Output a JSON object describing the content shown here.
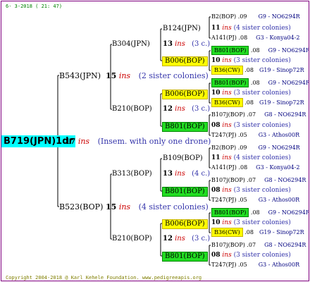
{
  "date_line": "6- 3-2018 ( 21: 47)",
  "copyright": "Copyright 2004-2018 @ Karl Kehele Foundation.  www.pedigreeapis.org",
  "root": {
    "name": "B719(JPN)1dr",
    "num": "17",
    "ins": "ins",
    "note": "(Insem. with only one drone)"
  },
  "gen1": [
    {
      "name": "B543(JPN)",
      "num": "15",
      "ins": "ins",
      "note": "(2 sister colonies)"
    },
    {
      "name": "B523(BOP)",
      "num": "15",
      "ins": "ins",
      "note": "(4 sister colonies)"
    }
  ],
  "gen2": [
    {
      "name": "B304(JPN)",
      "num": "13",
      "ins": "ins",
      "note": "(3 c.)"
    },
    {
      "name": "B210(BOP)",
      "num": "12",
      "ins": "ins",
      "note": "(3 c.)"
    },
    {
      "name": "B313(BOP)",
      "num": "13",
      "ins": "ins",
      "note": "(4 c.)"
    },
    {
      "name": "B210(BOP)",
      "num": "12",
      "ins": "ins",
      "note": "(3 c.)"
    }
  ],
  "gen3": [
    {
      "name": "B124(JPN)",
      "num": "11",
      "ins": "ins",
      "note": "(4 sister colonies)",
      "hl": ""
    },
    {
      "name": "B006(BOP)",
      "num": "10",
      "ins": "ins",
      "note": "(3 sister colonies)",
      "hl": "yel"
    },
    {
      "name": "B006(BOP)",
      "num": "10",
      "ins": "ins",
      "note": "(3 sister colonies)",
      "hl": "yel"
    },
    {
      "name": "B801(BOP)",
      "num": "08",
      "ins": "ins",
      "note": "(3 sister colonies)",
      "hl": "grn"
    },
    {
      "name": "B109(BOP)",
      "num": "11",
      "ins": "ins",
      "note": "(4 sister colonies)",
      "hl": ""
    },
    {
      "name": "B801(BOP)",
      "num": "08",
      "ins": "ins",
      "note": "(3 sister colonies)",
      "hl": "grn"
    },
    {
      "name": "B006(BOP)",
      "num": "10",
      "ins": "ins",
      "note": "(3 sister colonies)",
      "hl": "yel"
    },
    {
      "name": "B801(BOP)",
      "num": "08",
      "ins": "ins",
      "note": "(3 sister colonies)",
      "hl": "grn"
    }
  ],
  "gen4": [
    {
      "name": "B2(BOP)",
      "yr": ".09",
      "code": "G9 - NO6294R",
      "hl": ""
    },
    {
      "name": "A141(PJ)",
      "yr": ".08",
      "code": "G3 - Konya04-2",
      "hl": ""
    },
    {
      "name": "B801(BOP)",
      "yr": ".08",
      "code": "G9 - NO6294R",
      "hl": "grn"
    },
    {
      "name": "B36(CW)",
      "yr": ".08",
      "code": "G19 - Sinop72R",
      "hl": "yel"
    },
    {
      "name": "B801(BOP)",
      "yr": ".08",
      "code": "G9 - NO6294R",
      "hl": "grn"
    },
    {
      "name": "B36(CW)",
      "yr": ".08",
      "code": "G19 - Sinop72R",
      "hl": "yel"
    },
    {
      "name": "B107j(BOP)",
      "yr": ".07",
      "code": "G8 - NO6294R",
      "hl": ""
    },
    {
      "name": "T247(PJ)",
      "yr": ".05",
      "code": "G3 - Athos00R",
      "hl": ""
    },
    {
      "name": "B2(BOP)",
      "yr": ".09",
      "code": "G9 - NO6294R",
      "hl": ""
    },
    {
      "name": "A141(PJ)",
      "yr": ".08",
      "code": "G3 - Konya04-2",
      "hl": ""
    },
    {
      "name": "B107j(BOP)",
      "yr": ".07",
      "code": "G8 - NO6294R",
      "hl": ""
    },
    {
      "name": "T247(PJ)",
      "yr": ".05",
      "code": "G3 - Athos00R",
      "hl": ""
    },
    {
      "name": "B801(BOP)",
      "yr": ".08",
      "code": "G9 - NO6294R",
      "hl": "grn"
    },
    {
      "name": "B36(CW)",
      "yr": ".08",
      "code": "G19 - Sinop72R",
      "hl": "yel"
    },
    {
      "name": "B107j(BOP)",
      "yr": ".07",
      "code": "G8 - NO6294R",
      "hl": ""
    },
    {
      "name": "T247(PJ)",
      "yr": ".05",
      "code": "G3 - Athos00R",
      "hl": ""
    }
  ]
}
